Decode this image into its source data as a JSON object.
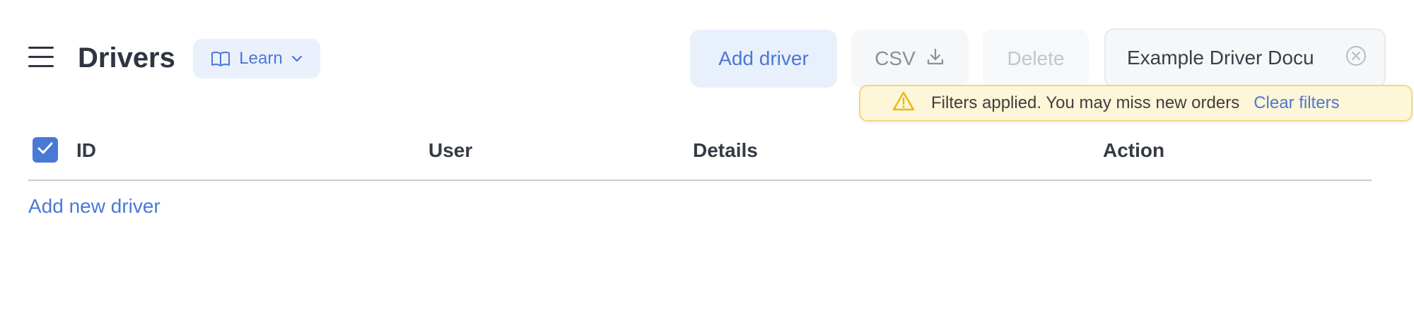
{
  "header": {
    "title": "Drivers",
    "learn_label": "Learn"
  },
  "toolbar": {
    "add_driver_label": "Add driver",
    "csv_label": "CSV",
    "delete_label": "Delete",
    "filter_value": "Example Driver Docu"
  },
  "warning": {
    "message": "Filters applied. You may miss new orders",
    "clear_label": "Clear filters"
  },
  "table": {
    "columns": [
      "ID",
      "User",
      "Details",
      "Action"
    ],
    "select_all_checked": true
  },
  "add_new_label": "Add new driver",
  "colors": {
    "accent": "#4a78d6",
    "warning_bg": "#fdf6d8",
    "warning_border": "#f1d97a",
    "warning_icon": "#e7b719"
  },
  "icons": {
    "menu": "hamburger-icon",
    "learn": "book-icon",
    "learn_caret": "chevron-down-icon",
    "csv": "download-icon",
    "filter_clear": "close-circle-icon",
    "warning": "warning-triangle-icon",
    "checkbox": "checkmark-icon"
  }
}
